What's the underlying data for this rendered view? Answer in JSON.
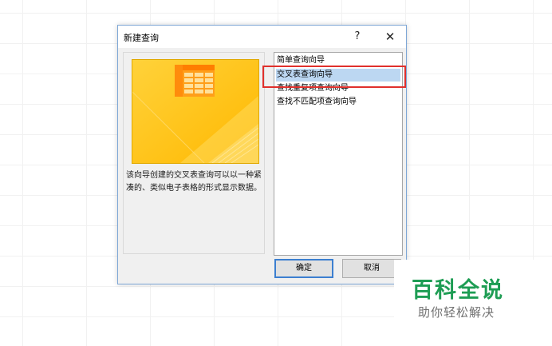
{
  "dialog": {
    "title": "新建查询",
    "help_label": "?",
    "close_label": "✕",
    "description": "该向导创建的交叉表查询可以以一种紧凑的、类似电子表格的形式显示数据。",
    "wizard_list": [
      {
        "label": "简单查询向导",
        "selected": false
      },
      {
        "label": "交叉表查询向导",
        "selected": true
      },
      {
        "label": "查找重复项查询向导",
        "selected": false
      },
      {
        "label": "查找不匹配项查询向导",
        "selected": false
      }
    ],
    "ok_label": "确定",
    "cancel_label": "取消"
  },
  "watermark": {
    "title": "百科全说",
    "subtitle": "助你轻松解决"
  },
  "colors": {
    "preview_yellow": "#ffc21a",
    "selection": "#bcd7f2",
    "highlight_red": "#e0302c",
    "watermark_green": "#1e9d54"
  }
}
